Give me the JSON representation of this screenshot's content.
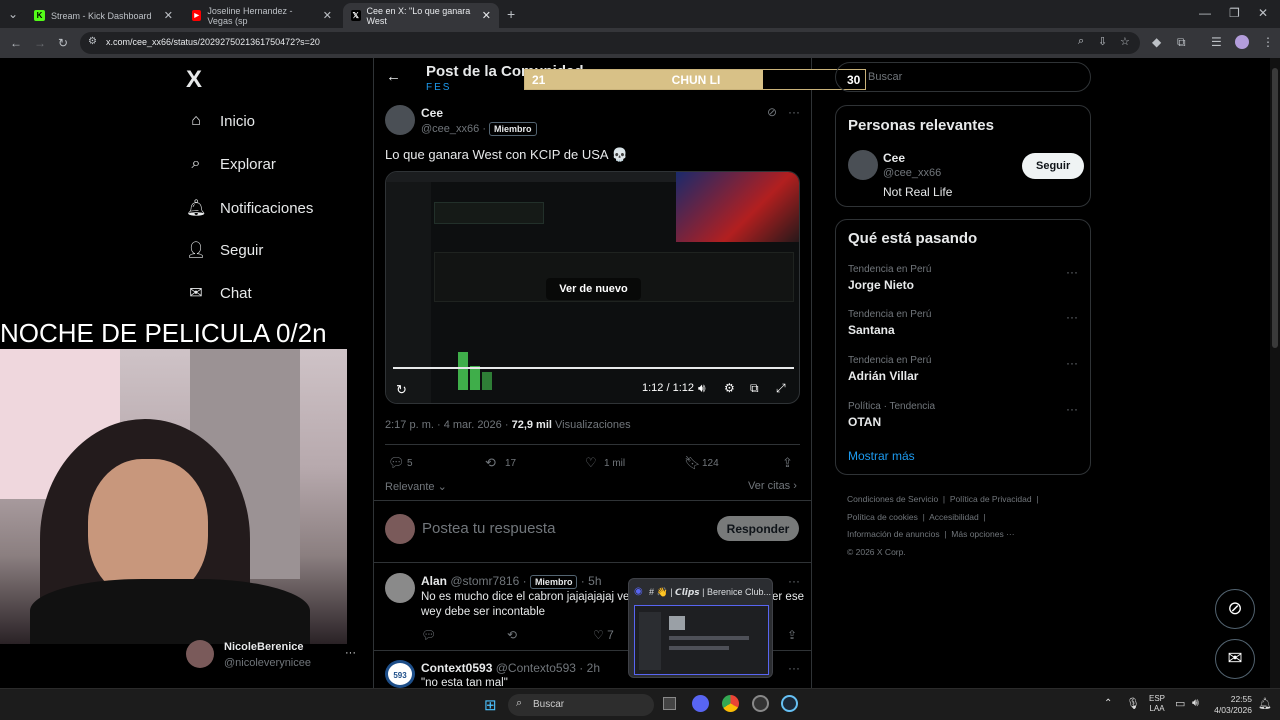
{
  "browser": {
    "tabs": [
      {
        "label": "Stream - Kick Dashboard",
        "active": false
      },
      {
        "label": "Joseline Hernandez - Vegas (sp",
        "active": false
      },
      {
        "label": "Cee en X: \"Lo que ganara West",
        "active": true
      }
    ],
    "url": "x.com/cee_xx66/status/2029275021361750472?s=20"
  },
  "nav": {
    "logo": "X",
    "items": [
      "Inicio",
      "Explorar",
      "Notificaciones",
      "Seguir",
      "Chat"
    ]
  },
  "overlay": {
    "movie_night": "NOCHE DE PELICULA 0/2n",
    "streamer_name": "NicoleBerenice",
    "streamer_handle": "@nicoleverynicee"
  },
  "scoreboard": {
    "left": "21",
    "name": "CHUN LI",
    "right": "30",
    "fill": 0.7
  },
  "header": {
    "title": "Post de la Comunidad",
    "subtitle": "FES"
  },
  "post": {
    "author": "Cee",
    "handle": "@cee_xx66",
    "badge": "Miembro",
    "text": "Lo que ganara West con KCIP de USA 💀",
    "replay_label": "Ver de nuevo",
    "time_display": "1:12 / 1:12",
    "timestamp": "2:17 p. m. · 4 mar. 2026 ·",
    "views": "72,9 mil",
    "views_label": "Visualizaciones",
    "replies": "5",
    "reposts": "17",
    "likes": "1 mil",
    "bookmarks": "124",
    "sort_label": "Relevante",
    "quotes_label": "Ver citas"
  },
  "reply_box": {
    "placeholder": "Postea tu respuesta",
    "button": "Responder"
  },
  "replies": [
    {
      "author": "Alan",
      "handle": "@stomr7816",
      "badge": "Miembro",
      "time": "5h",
      "text": "No es mucho dice el cabron jajajajajaj ve",
      "text2": "er ese",
      "text3": "wey debe ser incontable",
      "likes": "7"
    },
    {
      "author": "Context0593",
      "handle": "@Contexto593",
      "time": "2h",
      "text": "\"no esta tan mal\""
    }
  ],
  "search": {
    "placeholder": "Buscar"
  },
  "relevant": {
    "title": "Personas relevantes",
    "name": "Cee",
    "handle": "@cee_xx66",
    "bio": "Not Real Life",
    "follow": "Seguir"
  },
  "trends": {
    "title": "Qué está pasando",
    "items": [
      {
        "category": "Tendencia en Perú",
        "name": "Jorge Nieto"
      },
      {
        "category": "Tendencia en Perú",
        "name": "Santana"
      },
      {
        "category": "Tendencia en Perú",
        "name": "Adrián Villar"
      },
      {
        "category": "Política · Tendencia",
        "name": "OTAN"
      }
    ],
    "more": "Mostrar más"
  },
  "footer": {
    "links": [
      "Condiciones de Servicio",
      "Política de Privacidad",
      "Política de cookies",
      "Accesibilidad",
      "Información de anuncios",
      "Más opciones ···"
    ],
    "copyright": "© 2026 X Corp."
  },
  "popup": {
    "title": "# 👋 | 𝘾𝙡𝙞𝙥𝙨 | Berenice Club..."
  },
  "taskbar": {
    "search": "Buscar",
    "lang1": "ESP",
    "lang2": "LAA",
    "time": "22:55",
    "date": "4/03/2026"
  }
}
